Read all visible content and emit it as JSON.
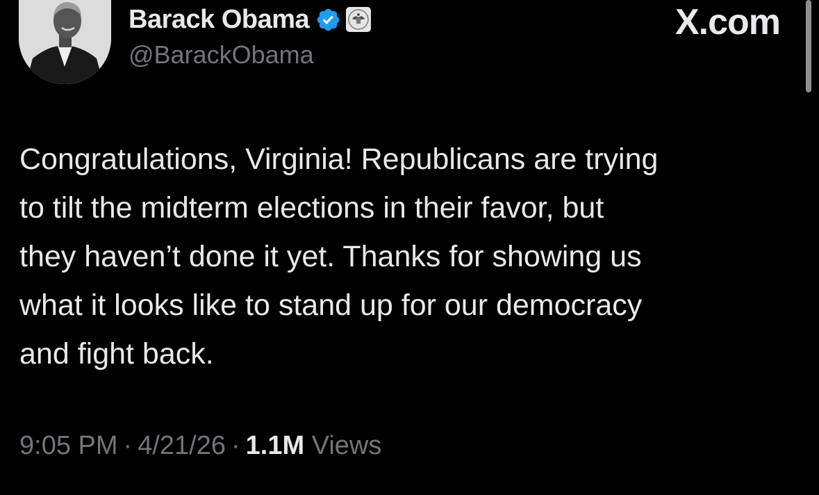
{
  "author": {
    "display_name": "Barack Obama",
    "handle": "@BarackObama",
    "verified_icon": "verified-badge-icon",
    "affiliation_icon": "government-seal-icon",
    "verified_color": "#1d9bf0"
  },
  "watermark": "X.com",
  "tweet": {
    "text": "Congratulations, Virginia! Republicans are trying\nto tilt the midterm elections in their favor, but\nthey haven’t done it yet. Thanks for showing us\nwhat it looks like to stand up for our democracy\nand fight back."
  },
  "meta": {
    "time": "9:05 PM",
    "date": "4/21/26",
    "separator": "·",
    "views_count": "1.1M",
    "views_label": "Views"
  },
  "colors": {
    "background": "#000000",
    "primary_text": "#e7e9ea",
    "secondary_text": "#71767b"
  }
}
